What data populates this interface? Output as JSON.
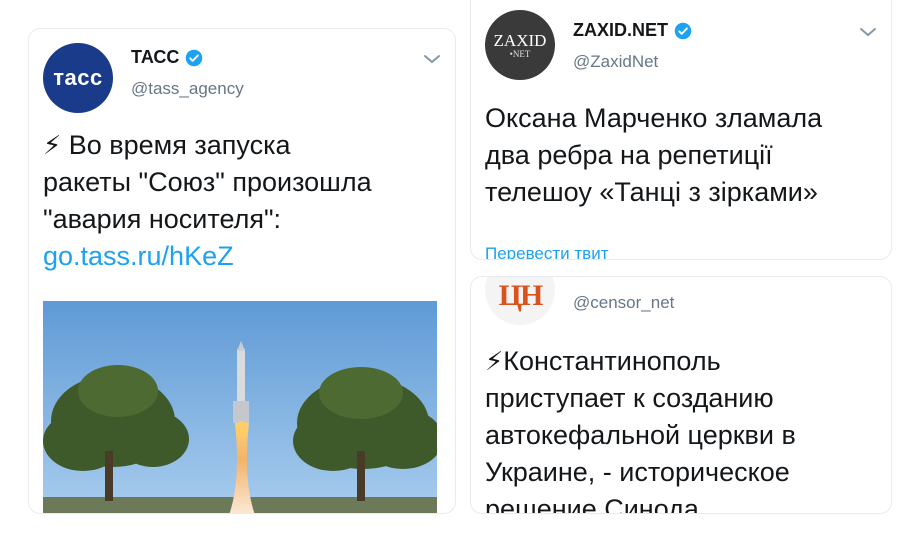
{
  "tass": {
    "avatar_text": "тасс",
    "name": "ТАСС",
    "handle": "@tass_agency",
    "emoji": "⚡",
    "text": " Во время запуска\nракеты \"Союз\" произошла\n\"авария носителя\":",
    "link": "go.tass.ru/hKeZ"
  },
  "zaxid": {
    "avatar_line1": "ZAXID",
    "avatar_line2": "•NET",
    "name": "ZAXID.NET",
    "handle": "@ZaxidNet",
    "text": "Оксана Марченко зламала\nдва ребра на репетиції\nтелешоу «Танці з зірками»",
    "translate": "Перевести твит"
  },
  "censor": {
    "avatar_text": "ЦН",
    "handle": "@censor_net",
    "emoji": "⚡",
    "text": "Константинополь\nприступает к созданию\nавтокефальной церкви в\nУкраине, - историческое\nрешение Синода"
  },
  "colors": {
    "link": "#1da1f2",
    "verified": "#1da1f2",
    "text": "#14171a",
    "muted": "#657786"
  },
  "icons": [
    "verified-badge-icon",
    "chevron-down-icon",
    "lightning-icon"
  ]
}
